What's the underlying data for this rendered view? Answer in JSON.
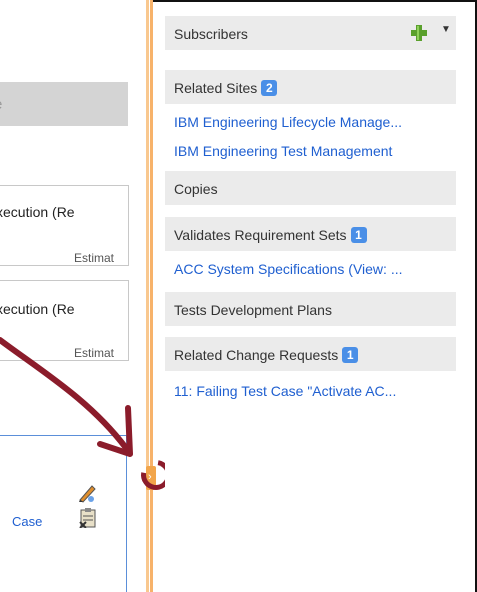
{
  "left_pane": {
    "gray_field_text": "e",
    "rows": [
      {
        "text": "xecution (Re",
        "align": "left"
      },
      {
        "text": "Estimat",
        "align": "right"
      },
      {
        "text": "xecution (Re",
        "align": "left"
      },
      {
        "text": "Estimat",
        "align": "right"
      }
    ],
    "bottom_case_text": "Case"
  },
  "panel": {
    "subscribers_label": "Subscribers",
    "related_sites": {
      "label": "Related Sites",
      "count": "2",
      "links": [
        "IBM Engineering Lifecycle Manage...",
        "IBM Engineering Test Management"
      ]
    },
    "copies_label": "Copies",
    "validates": {
      "label": "Validates Requirement Sets",
      "count": "1",
      "links": [
        "ACC System Specifications (View: ..."
      ]
    },
    "dev_plans_label": "Tests Development Plans",
    "change_requests": {
      "label": "Related Change Requests",
      "count": "1",
      "links": [
        "11: Failing Test Case \"Activate AC..."
      ]
    }
  },
  "colors": {
    "accent": "#8b1c2b",
    "link": "#1f5fd0",
    "badge": "#4a8fe7",
    "divider": "#f7b26a"
  }
}
